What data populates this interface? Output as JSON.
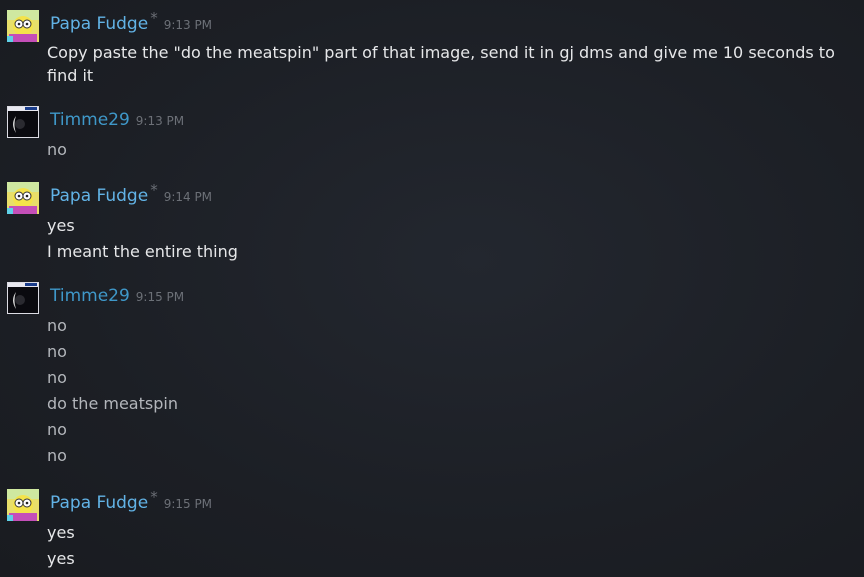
{
  "messages": [
    {
      "author": "Papa Fudge",
      "star": "*",
      "time": "9:13 PM",
      "lines": [
        "Copy paste the \"do the meatspin\" part of that image, send it in gj dms and give me 10 seconds to find it"
      ]
    },
    {
      "author": "Timme29",
      "time": "9:13 PM",
      "lines": [
        "no"
      ]
    },
    {
      "author": "Papa Fudge",
      "star": "*",
      "time": "9:14 PM",
      "lines": [
        "yes",
        "I meant the entire thing"
      ]
    },
    {
      "author": "Timme29",
      "time": "9:15 PM",
      "lines": [
        "no",
        "no",
        "no",
        "do the meatspin",
        "no",
        "no"
      ]
    },
    {
      "author": "Papa Fudge",
      "star": "*",
      "time": "9:15 PM",
      "lines": [
        "yes",
        "yes"
      ]
    }
  ],
  "colors": {
    "background": "#1c1f25",
    "papa_name": "#62b3e6",
    "timme_name": "#3f98c9",
    "message_text": "#e6e7e9",
    "timestamp": "#6c7077"
  },
  "icons": {
    "papa_avatar": "cartoon-avatar-icon",
    "timme_avatar": "dark-window-avatar-icon"
  }
}
